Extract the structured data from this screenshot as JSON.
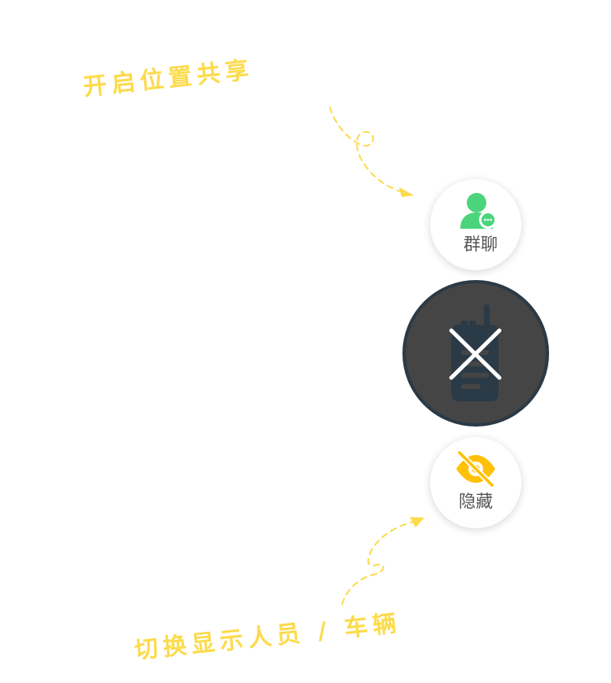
{
  "hints": {
    "location_sharing": "开启位置共享",
    "toggle_display": "切换显示人员 / 车辆"
  },
  "buttons": {
    "group_chat_label": "群聊",
    "hide_label": "隐藏",
    "main_icon": "walkie-talkie-icon",
    "main_overlay_icon": "close-icon"
  },
  "colors": {
    "hint_yellow": "#FCDB4C",
    "chat_green": "#4CD47C",
    "hide_yellow": "#FFC107",
    "main_bg": "#454545",
    "main_border": "#2B3A47"
  }
}
